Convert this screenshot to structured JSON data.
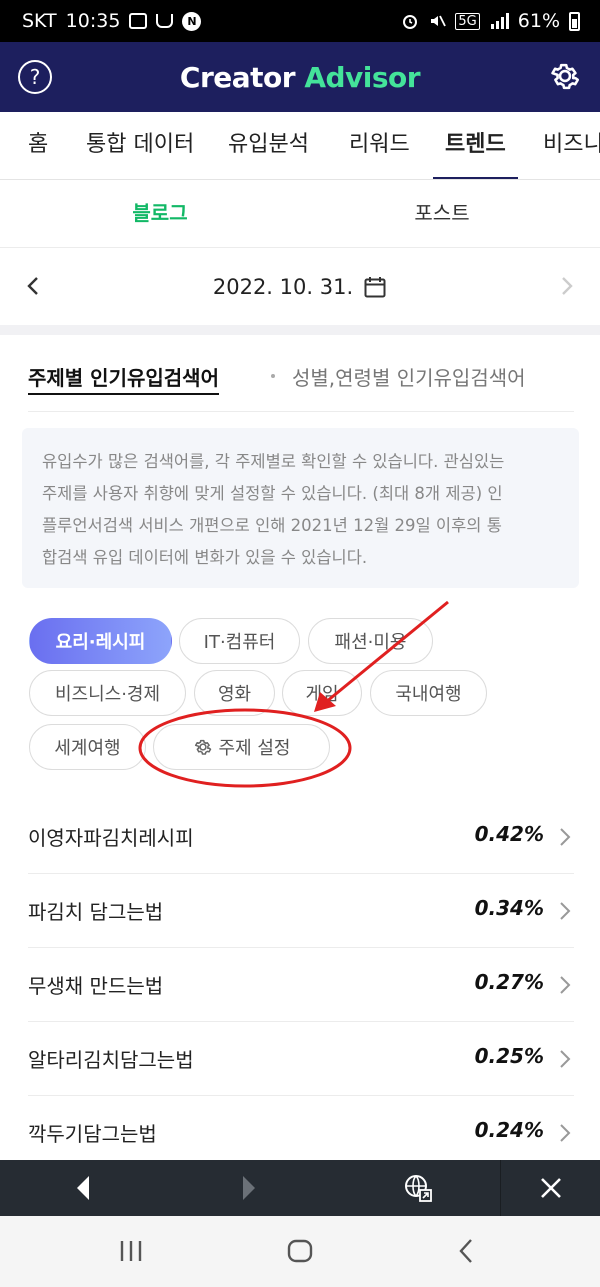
{
  "status_bar": {
    "carrier": "SKT",
    "time": "10:35",
    "network": "5G",
    "battery": "61%"
  },
  "header": {
    "title_part1": "Creator",
    "title_part2": "Advisor",
    "help_icon": "?"
  },
  "main_tabs": [
    {
      "label": "홈"
    },
    {
      "label": "통합 데이터"
    },
    {
      "label": "유입분석"
    },
    {
      "label": "리워드"
    },
    {
      "label": "트렌드"
    },
    {
      "label": "비즈니스"
    }
  ],
  "sub_tabs": [
    {
      "label": "블로그"
    },
    {
      "label": "포스트"
    }
  ],
  "date": "2022. 10. 31.",
  "section_tabs": {
    "active": "주제별 인기유입검색어",
    "inactive": "성별,연령별 인기유입검색어"
  },
  "info": {
    "lines": [
      "유입수가 많은 검색어를, 각 주제별로 확인할 수 있습니다. 관심있는",
      "주제를 사용자 취향에 맞게 설정할 수 있습니다. (최대 8개 제공) 인",
      "플루언서검색 서비스 개편으로 인해 2021년 12월 29일 이후의 통",
      "합검색 유입 데이터에 변화가 있을 수 있습니다."
    ]
  },
  "chips": [
    {
      "label": "요리·레시피"
    },
    {
      "label": "IT·컴퓨터"
    },
    {
      "label": "패션·미용"
    },
    {
      "label": "비즈니스·경제"
    },
    {
      "label": "영화"
    },
    {
      "label": "게임"
    },
    {
      "label": "국내여행"
    },
    {
      "label": "세계여행"
    }
  ],
  "settings_chip": {
    "label": "주제 설정"
  },
  "keywords": [
    {
      "keyword": "이영자파김치레시피",
      "value": "0.42%"
    },
    {
      "keyword": "파김치 담그는법",
      "value": "0.34%"
    },
    {
      "keyword": "무생채 만드는법",
      "value": "0.27%"
    },
    {
      "keyword": "알타리김치담그는법",
      "value": "0.25%"
    },
    {
      "keyword": "깍두기담그는법",
      "value": "0.24%"
    }
  ],
  "colors": {
    "header_bg": "#1d1f5e",
    "brand_green": "#44e39a",
    "active_subtab": "#12b866",
    "annotation_red": "#e02020"
  }
}
